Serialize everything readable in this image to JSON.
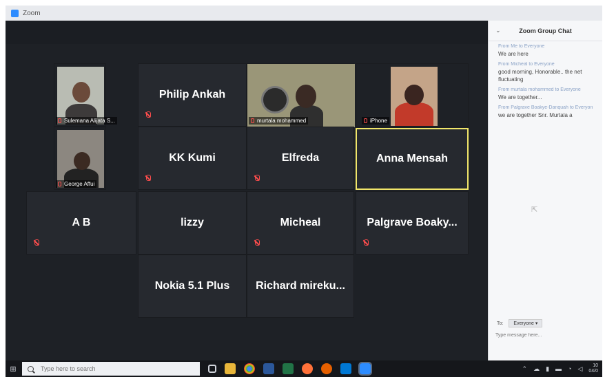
{
  "window": {
    "title": "Zoom"
  },
  "gallery": {
    "video_tiles": [
      {
        "label": "Sulemana Alijata S..."
      },
      {
        "label": "murtala mohammed"
      },
      {
        "label": "iPhone"
      },
      {
        "label": "George Affui"
      }
    ],
    "name_tiles": [
      {
        "name": "Philip Ankah"
      },
      {
        "name": "KK Kumi"
      },
      {
        "name": "Elfreda"
      },
      {
        "name": "Anna Mensah"
      },
      {
        "name": "A B"
      },
      {
        "name": "lizzy"
      },
      {
        "name": "Micheal"
      },
      {
        "name": "Palgrave  Boaky..."
      },
      {
        "name": "Nokia 5.1 Plus"
      },
      {
        "name": "Richard  mireku..."
      }
    ]
  },
  "chat": {
    "title": "Zoom Group Chat",
    "messages": [
      {
        "from": "From Me to Everyone",
        "text": "We are here"
      },
      {
        "from": "From Micheal to Everyone",
        "text": "good morning, Honorable.. the net fluctuating"
      },
      {
        "from": "From murtala mohammed to Everyone",
        "text": "We are together..."
      },
      {
        "from": "From Palgrave Boakye-Danquah to Everyone",
        "text": "we are together Snr. Murtala a"
      }
    ],
    "to_label": "To:",
    "to_value": "Everyone ▾",
    "input_placeholder": "Type message here..."
  },
  "taskbar": {
    "search_placeholder": "Type here to search",
    "clock_time": "10",
    "clock_date": "04/0"
  },
  "colors": {
    "active_speaker_border": "#f1e66a",
    "muted_icon": "#ff4d4d",
    "tile_bg": "#26292f",
    "zoom_blue": "#2d8cff"
  }
}
